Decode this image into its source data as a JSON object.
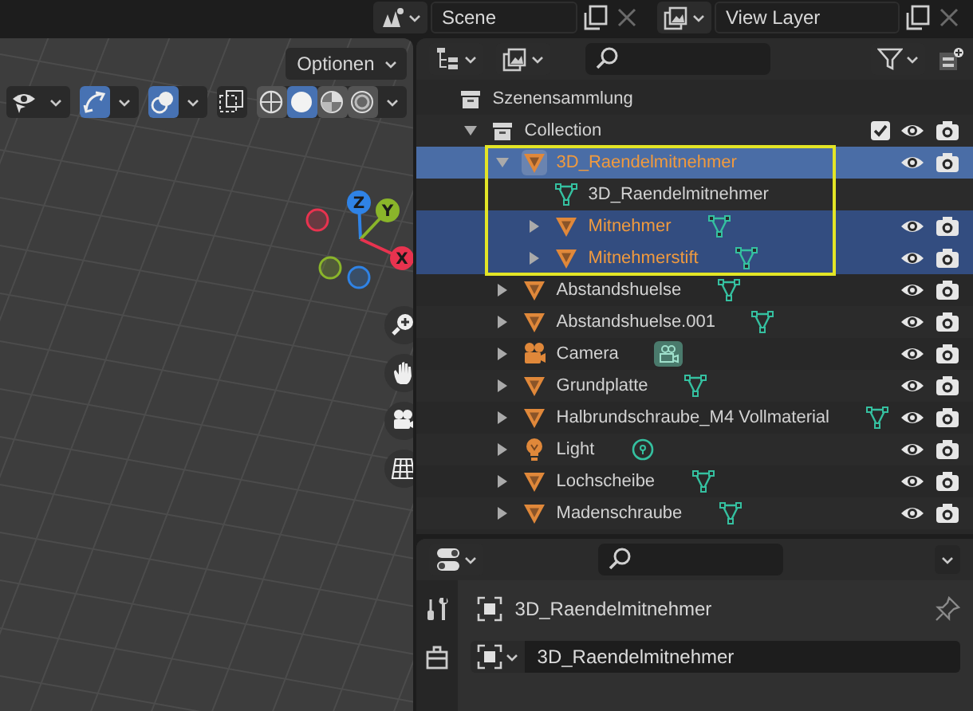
{
  "header": {
    "scene": "Scene",
    "view_layer": "View Layer"
  },
  "viewport": {
    "options": "Optionen",
    "toggles": [
      {
        "kind": "visibility",
        "on": false
      },
      {
        "kind": "gizmo",
        "on": true
      },
      {
        "kind": "overlay",
        "on": true
      },
      {
        "kind": "xray",
        "on": false
      }
    ],
    "shading": [
      {
        "kind": "wireframe",
        "selected": false
      },
      {
        "kind": "solid",
        "selected": true
      },
      {
        "kind": "material",
        "selected": false
      },
      {
        "kind": "rendered",
        "selected": false
      }
    ],
    "gizmo_axes": [
      "Z",
      "Y",
      "X"
    ]
  },
  "outliner": {
    "tree": [
      {
        "kind": "scene_collection",
        "name": "Szenensammlung",
        "children": [
          {
            "kind": "collection",
            "name": "Collection",
            "expanded": true,
            "checked": true,
            "children": [
              {
                "kind": "mesh",
                "name": "3D_Raendelmitnehmer",
                "expanded": true,
                "selected": true,
                "active": true,
                "highlighted": true,
                "children": [
                  {
                    "kind": "mesh_data",
                    "name": "3D_Raendelmitnehmer"
                  },
                  {
                    "kind": "mesh",
                    "name": "Mitnehmer",
                    "expanded": false,
                    "selected": true,
                    "active": false
                  },
                  {
                    "kind": "mesh",
                    "name": "Mitnehmerstift",
                    "expanded": false,
                    "selected": true,
                    "active": false
                  }
                ]
              },
              {
                "kind": "mesh",
                "name": "Abstandshuelse",
                "expanded": false,
                "selected": false,
                "active": false
              },
              {
                "kind": "mesh",
                "name": "Abstandshuelse.001",
                "expanded": false,
                "selected": false,
                "active": false
              },
              {
                "kind": "camera",
                "name": "Camera",
                "expanded": false,
                "selected": false,
                "active": false
              },
              {
                "kind": "mesh",
                "name": "Grundplatte",
                "expanded": false,
                "selected": false,
                "active": false
              },
              {
                "kind": "mesh",
                "name": "Halbrundschraube_M4 Vollmaterial",
                "expanded": false,
                "selected": false,
                "active": false
              },
              {
                "kind": "light",
                "name": "Light",
                "expanded": false,
                "selected": false,
                "active": false
              },
              {
                "kind": "mesh",
                "name": "Lochscheibe",
                "expanded": false,
                "selected": false,
                "active": false
              },
              {
                "kind": "mesh",
                "name": "Madenschraube",
                "expanded": false,
                "selected": false,
                "active": false
              }
            ]
          }
        ]
      }
    ]
  },
  "properties": {
    "object_name": "3D_Raendelmitnehmer",
    "name_field": "3D_Raendelmitnehmer"
  }
}
